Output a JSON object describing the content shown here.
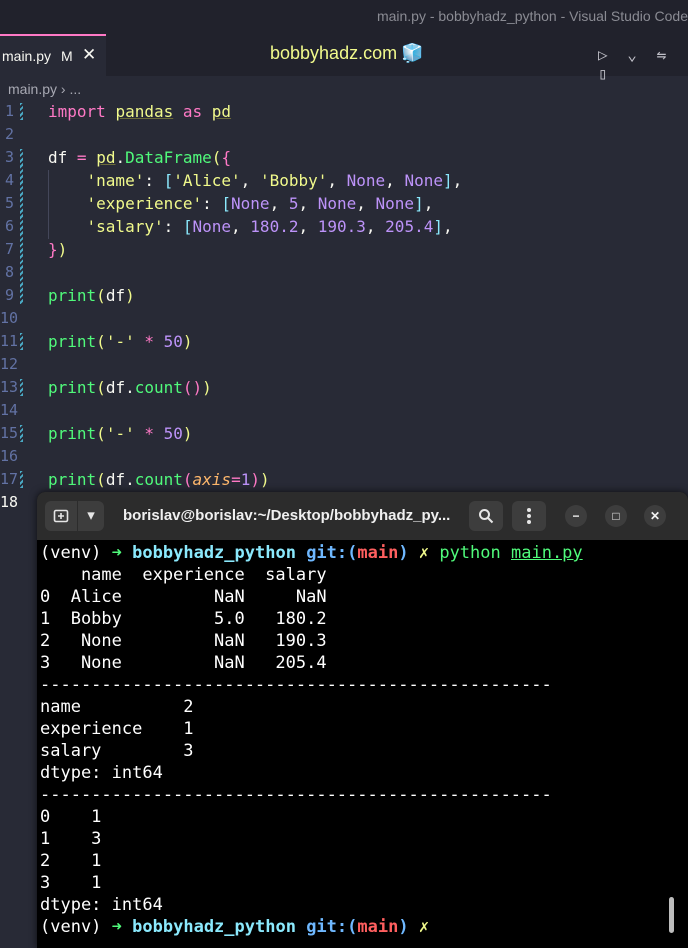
{
  "window": {
    "title": "main.py - bobbyhadz_python - Visual Studio Code"
  },
  "tab": {
    "filename": "main.py",
    "modified_marker": "M",
    "close_glyph": "✕"
  },
  "center_title": {
    "text": "bobbyhadz.com",
    "icon": "ice-cube-icon",
    "glyph": "🧊"
  },
  "editor_actions": [
    {
      "name": "run-icon",
      "glyph": "▷"
    },
    {
      "name": "chevron-down-icon",
      "glyph": "⌄"
    },
    {
      "name": "compare-changes-icon",
      "glyph": "⇋"
    },
    {
      "name": "split-editor-icon",
      "glyph": "▯"
    }
  ],
  "breadcrumb": {
    "file": "main.py",
    "separator": "›",
    "rest": "..."
  },
  "line_numbers": [
    "1",
    "2",
    "3",
    "4",
    "5",
    "6",
    "7",
    "8",
    "9",
    "10",
    "11",
    "12",
    "13",
    "14",
    "15",
    "16",
    "17",
    "18"
  ],
  "code": {
    "l1_kw1": "import",
    "l1_mod": "pandas",
    "l1_kw2": "as",
    "l1_alias": "pd",
    "l3_var": "df",
    "l3_eq": "=",
    "l3_mod": "pd",
    "l3_fn": "DataFrame",
    "l4_key": "'name'",
    "l4_v1": "'Alice'",
    "l4_v2": "'Bobby'",
    "l4_v3": "None",
    "l4_v4": "None",
    "l5_key": "'experience'",
    "l5_v1": "None",
    "l5_v2": "5",
    "l5_v3": "None",
    "l5_v4": "None",
    "l6_key": "'salary'",
    "l6_v1": "None",
    "l6_v2": "180.2",
    "l6_v3": "190.3",
    "l6_v4": "205.4",
    "print": "print",
    "df": "df",
    "dash": "'-'",
    "times": "*",
    "fifty": "50",
    "count": "count",
    "axis": "axis",
    "one": "1"
  },
  "terminal": {
    "title": "borislav@borislav:~/Desktop/bobbyhadz_py...",
    "prompt": {
      "venv": "(venv)",
      "arrow": "➜",
      "dir": "bobbyhadz_python",
      "git": "git:(",
      "branch": "main",
      "git_close": ")",
      "dirty": "✗"
    },
    "command": "python",
    "argument": "main.py",
    "output": [
      "    name  experience  salary",
      "0  Alice         NaN     NaN",
      "1  Bobby         5.0   180.2",
      "2   None         NaN   190.3",
      "3   None         NaN   205.4",
      "--------------------------------------------------",
      "name          2",
      "experience    1",
      "salary        3",
      "dtype: int64",
      "--------------------------------------------------",
      "0    1",
      "1    3",
      "2    1",
      "3    1",
      "dtype: int64"
    ]
  }
}
